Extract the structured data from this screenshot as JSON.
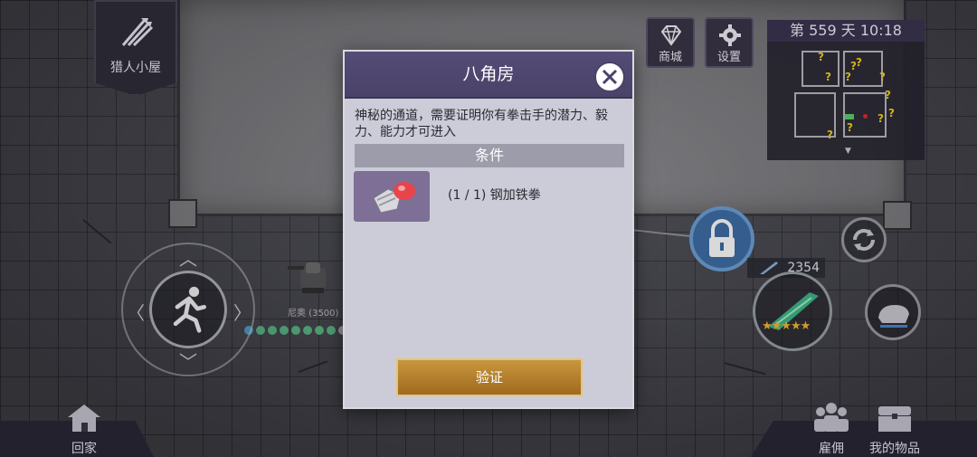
{
  "hud": {
    "hut_label": "猎人小屋",
    "shop_label": "商城",
    "settings_label": "设置",
    "day_text": "第 559 天   10:18",
    "power_value": "2354",
    "home_label": "回家",
    "hire_label": "雇佣",
    "items_label": "我的物品"
  },
  "player": {
    "name": "尼奥 (3500)"
  },
  "dialog": {
    "title": "八角房",
    "description": "神秘的通道，需要证明你有拳击手的潜力、毅力、能力才可进入",
    "conditions_header": "条件",
    "condition_text": "(1 / 1) 钢加铁拳",
    "verify_label": "验证"
  },
  "colors": {
    "dialog_header": "#4f4770",
    "dialog_body": "#ccccd8",
    "verify_button": "#b47e2c",
    "lock_button": "#3f6ea6",
    "minimap_marker": "#f4d21b"
  }
}
